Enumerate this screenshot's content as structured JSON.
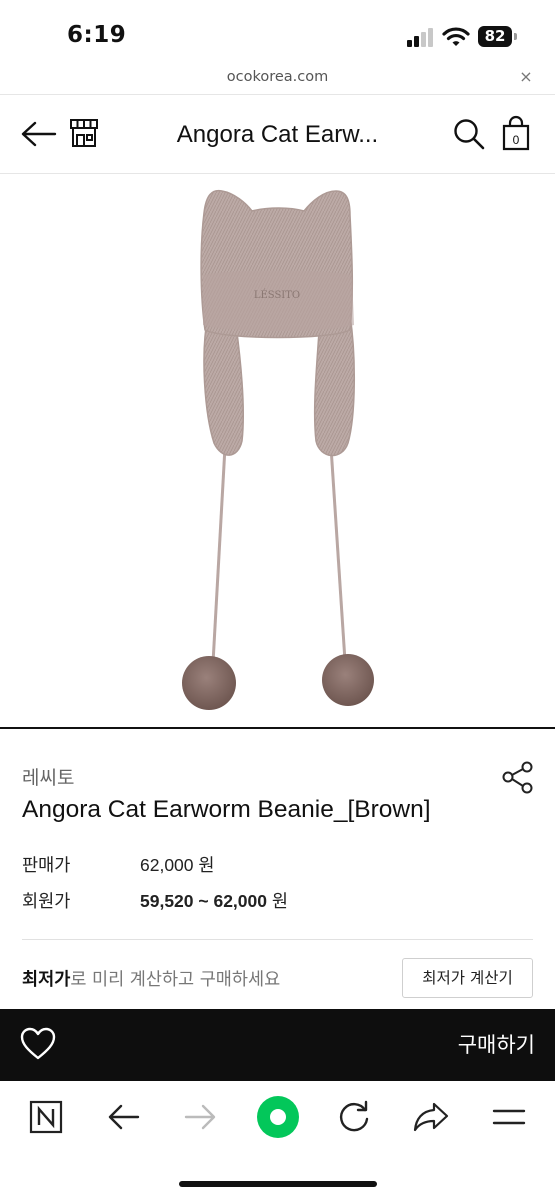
{
  "status_bar": {
    "time": "6:19",
    "battery": "82"
  },
  "browser": {
    "url": "ocokorea.com",
    "close_glyph": "×"
  },
  "header": {
    "title": "Angora Cat Earw..."
  },
  "product": {
    "brand": "레씨토",
    "name": "Angora Cat Earworm Beanie_[Brown]",
    "sale_label": "판매가",
    "sale_price": "62,000",
    "member_label": "회원가",
    "member_price": "59,520 ~ 62,000",
    "currency": "원",
    "image_logo_text": "LÉSSITO"
  },
  "lowest": {
    "bold": "최저가",
    "rest": "로 미리 계산하고 구매하세요",
    "button": "최저가 계산기"
  },
  "buybar": {
    "buy_label": "구매하기"
  },
  "icons": {
    "back": "arrow-left-icon",
    "store": "storefront-icon",
    "search": "search-icon",
    "bag": "shopping-bag-icon",
    "bag_count": "0",
    "share": "share-icon",
    "wish": "heart-icon",
    "toolbar": [
      "naver-n-icon",
      "back-arrow-icon",
      "forward-arrow-icon",
      "green-circle-icon",
      "refresh-icon",
      "share-arrow-icon",
      "menu-icon"
    ]
  },
  "colors": {
    "accent_green": "#03c75a",
    "buy_bar": "#0e0e0e",
    "beanie": "#b9a7a3",
    "pompom": "#8c726d"
  }
}
